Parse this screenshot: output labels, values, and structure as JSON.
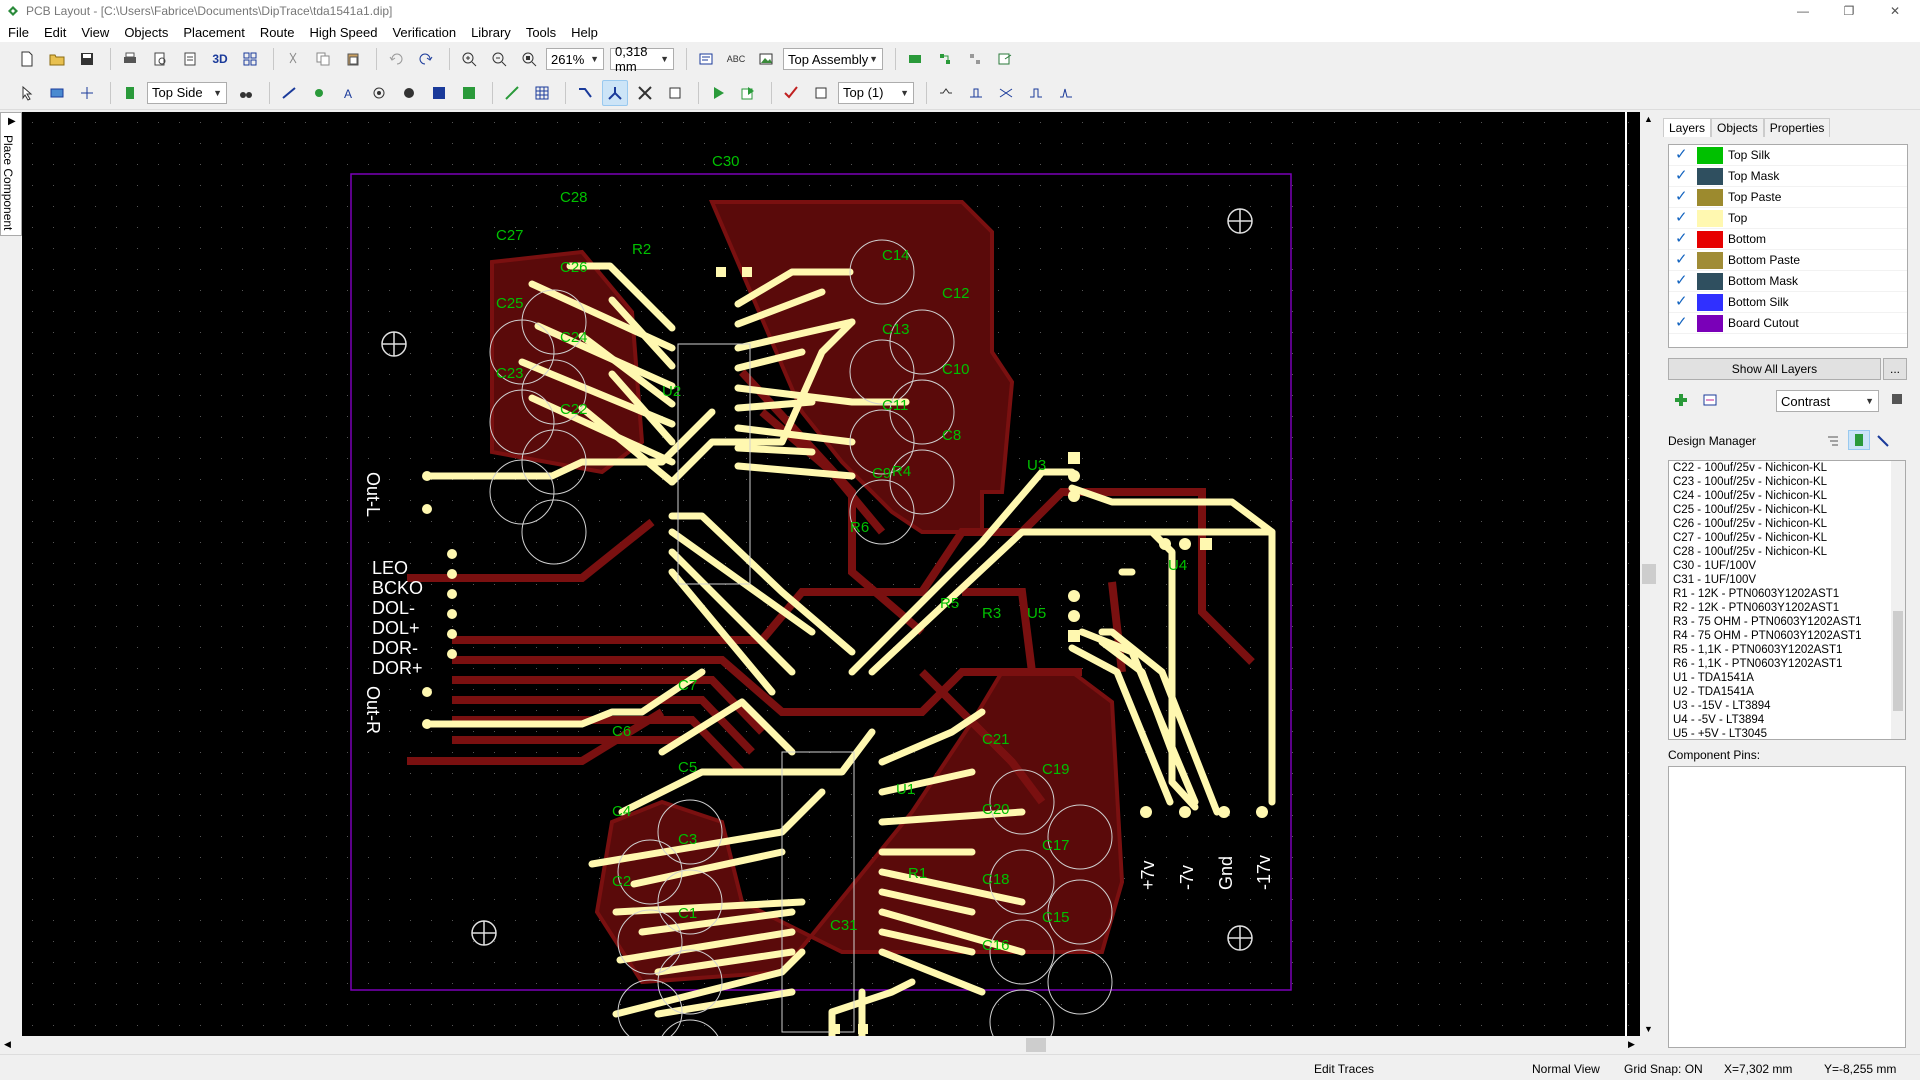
{
  "window": {
    "title": "PCB Layout - [C:\\Users\\Fabrice\\Documents\\DipTrace\\tda1541a1.dip]",
    "icon": "diptrace-logo-icon"
  },
  "menu": [
    "File",
    "Edit",
    "View",
    "Objects",
    "Placement",
    "Route",
    "High Speed",
    "Verification",
    "Library",
    "Tools",
    "Help"
  ],
  "toolbar1": {
    "zoom_value": "261%",
    "width_value": "0,318 mm",
    "abc_label": "ABC",
    "assembly_value": "Top Assembly",
    "three_d_label": "3D"
  },
  "toolbar2": {
    "side_value": "Top Side",
    "layer_value": "Top (1)"
  },
  "side_tab": {
    "label": "Place Component"
  },
  "right_panel": {
    "tabs": [
      "Layers",
      "Objects",
      "Properties"
    ],
    "layers": [
      {
        "name": "Top Silk",
        "color": "#00c000"
      },
      {
        "name": "Top Mask",
        "color": "#2f4f5f"
      },
      {
        "name": "Top Paste",
        "color": "#9c8a2e"
      },
      {
        "name": "Top",
        "color": "#fff8b0"
      },
      {
        "name": "Bottom",
        "color": "#e60000"
      },
      {
        "name": "Bottom Paste",
        "color": "#a08c36"
      },
      {
        "name": "Bottom Mask",
        "color": "#2f4f5f"
      },
      {
        "name": "Bottom Silk",
        "color": "#3030ff"
      },
      {
        "name": "Board Cutout",
        "color": "#7a00b8"
      }
    ],
    "show_all_label": "Show All Layers",
    "more_label": "...",
    "contrast_value": "Contrast",
    "design_manager_label": "Design Manager",
    "component_pins_label": "Component Pins:",
    "components": [
      "C22 - 100uf/25v - Nichicon-KL",
      "C23 - 100uf/25v - Nichicon-KL",
      "C24 - 100uf/25v - Nichicon-KL",
      "C25 - 100uf/25v - Nichicon-KL",
      "C26 - 100uf/25v - Nichicon-KL",
      "C27 - 100uf/25v - Nichicon-KL",
      "C28 - 100uf/25v - Nichicon-KL",
      "C30 - 1UF/100V",
      "C31 - 1UF/100V",
      "R1 - 12K - PTN0603Y1202AST1",
      "R2 - 12K - PTN0603Y1202AST1",
      "R3 - 75 OHM - PTN0603Y1202AST1",
      "R4 - 75 OHM - PTN0603Y1202AST1",
      "R5 - 1,1K - PTN0603Y1202AST1",
      "R6 - 1,1K - PTN0603Y1202AST1",
      "U1 - TDA1541A",
      "U2 - TDA1541A",
      "U3 - -15V - LT3894",
      "U4 - -5V - LT3894",
      "U5 - +5V - LT3045"
    ]
  },
  "status": {
    "mode": "Edit Traces",
    "view": "Normal View",
    "snap": "Grid Snap: ON",
    "x": "X=7,302 mm",
    "y": "Y=-8,255 mm"
  },
  "pcb": {
    "labels_left": [
      "Out-L",
      "LEO",
      "BCKO",
      "DOL-",
      "DOL+",
      "DOR-",
      "DOR+",
      "Out-R"
    ],
    "labels_bottom": [
      "+7v",
      "-7v",
      "Gnd",
      "-17v"
    ],
    "refdes": [
      "C30",
      "C28",
      "C27",
      "C26",
      "C25",
      "C24",
      "C23",
      "C22",
      "R2",
      "U2",
      "C14",
      "C13",
      "C12",
      "C11",
      "C10",
      "C9",
      "C8",
      "R4",
      "R6",
      "U3",
      "U4",
      "U5",
      "R5",
      "R3",
      "C7",
      "C6",
      "C5",
      "C4",
      "C3",
      "C2",
      "C1",
      "U1",
      "C21",
      "C19",
      "C20",
      "C17",
      "C18",
      "C15",
      "C16",
      "R1",
      "C31"
    ],
    "colors": {
      "top": "#fff8b0",
      "bottom": "#7a1010",
      "silk": "#00c000",
      "outline": "#7a00b8",
      "background": "#000000"
    }
  }
}
